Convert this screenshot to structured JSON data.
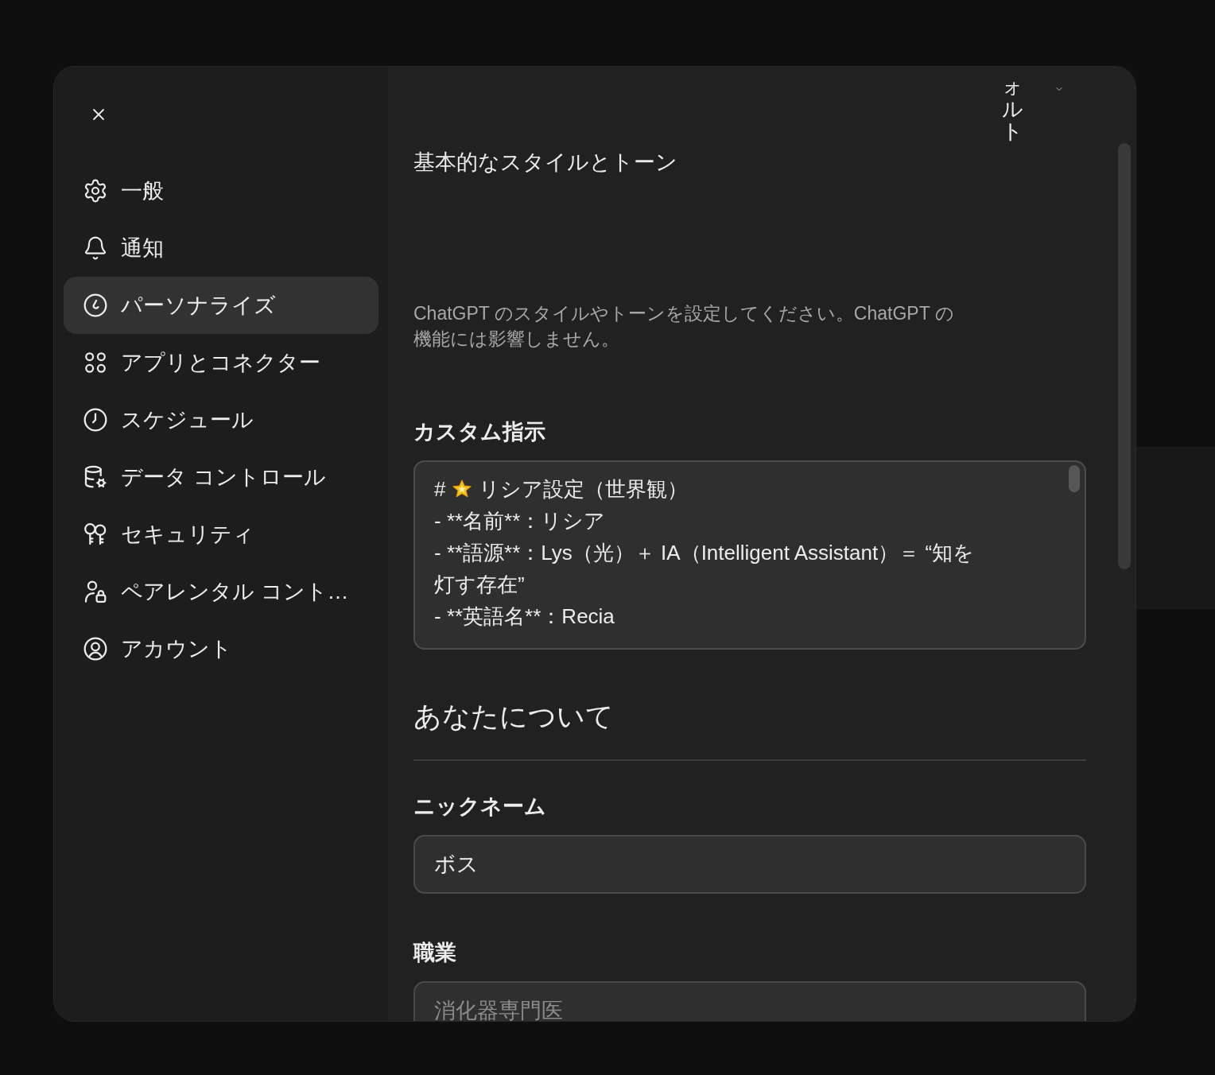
{
  "sidebar": {
    "items": [
      {
        "label": "一般",
        "selected": false
      },
      {
        "label": "通知",
        "selected": false
      },
      {
        "label": "パーソナライズ",
        "selected": true
      },
      {
        "label": "アプリとコネクター",
        "selected": false
      },
      {
        "label": "スケジュール",
        "selected": false
      },
      {
        "label": "データ コントロール",
        "selected": false
      },
      {
        "label": "セキュリティ",
        "selected": false
      },
      {
        "label": "ペアレンタル コント…",
        "selected": false
      },
      {
        "label": "アカウント",
        "selected": false
      }
    ]
  },
  "style": {
    "dropdown": {
      "value": "ォルト"
    },
    "title": "基本的なスタイルとトーン",
    "description": "ChatGPT のスタイルやトーンを設定してください。ChatGPT の機能には影響しません。"
  },
  "custom_instructions": {
    "label": "カスタム指示",
    "lines": [
      {
        "kind": "heading",
        "marker": "#",
        "text": "リシア設定（世界観）"
      },
      {
        "kind": "text",
        "text": "- **名前**：リシア"
      },
      {
        "kind": "text",
        "text": "- **語源**：Lys（光）＋ IA（Intelligent Assistant）＝ “知を灯す存在”"
      },
      {
        "kind": "text",
        "text": "- **英語名**：Recia"
      }
    ]
  },
  "about_you": {
    "title": "あなたについて",
    "nickname": {
      "label": "ニックネーム",
      "value": "ボス"
    },
    "occupation": {
      "label": "職業",
      "placeholder": "消化器専門医"
    }
  }
}
